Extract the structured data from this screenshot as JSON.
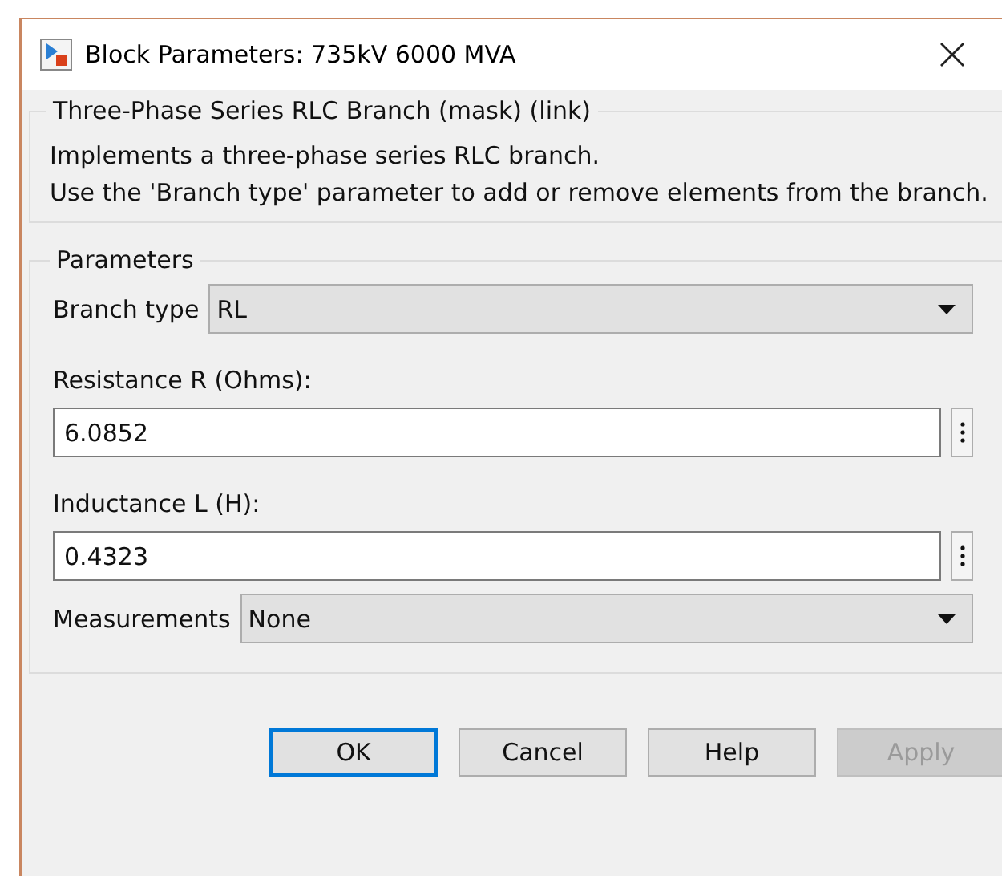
{
  "window": {
    "title": "Block Parameters: 735kV 6000 MVA"
  },
  "mask": {
    "title": "Three-Phase Series RLC Branch (mask) (link)",
    "description": [
      "Implements a three-phase series RLC branch.",
      "Use the 'Branch type' parameter to add or remove elements from the branch."
    ]
  },
  "parameters": {
    "title": "Parameters",
    "items": [
      {
        "kind": "dropdown",
        "label": "Branch type",
        "value": "RL"
      },
      {
        "kind": "edit",
        "label": "Resistance R (Ohms):",
        "value": "6.0852"
      },
      {
        "kind": "edit",
        "label": "Inductance L (H):",
        "value": "0.4323"
      },
      {
        "kind": "dropdown",
        "label": "Measurements",
        "value": "None"
      }
    ]
  },
  "buttons": [
    {
      "label": "OK",
      "focused": true,
      "disabled": false
    },
    {
      "label": "Cancel",
      "focused": false,
      "disabled": false
    },
    {
      "label": "Help",
      "focused": false,
      "disabled": false
    },
    {
      "label": "Apply",
      "focused": false,
      "disabled": true
    }
  ]
}
